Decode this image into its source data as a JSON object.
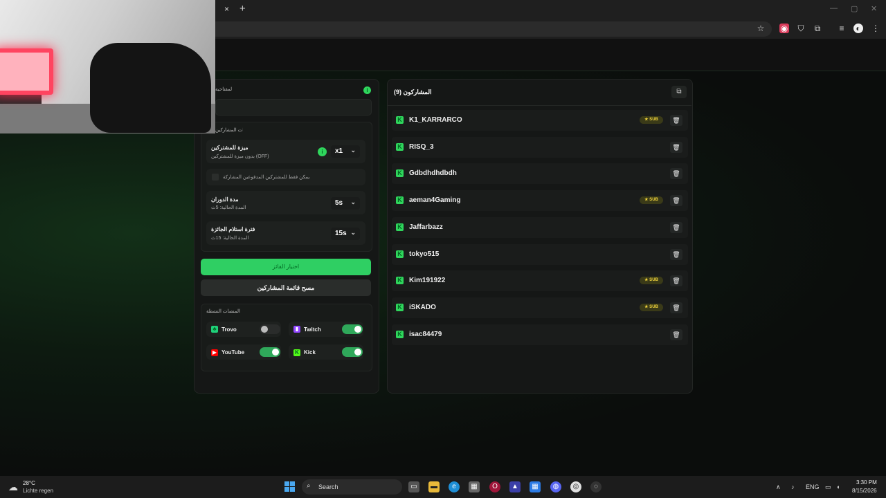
{
  "browser": {
    "tab_close": "×",
    "new_tab": "+",
    "win_min": "—",
    "win_max": "▢",
    "win_close": "✕"
  },
  "left": {
    "keyword_label": "الكلمة المفتاحية",
    "settings_title": "إعدادات المشاركين",
    "advantage": {
      "title": "ميزة للمشتركين",
      "subtitle": "بدون ميزة للمشتركين (OFF)",
      "value": "x1"
    },
    "paid_only": {
      "label": "يمكن فقط للمشتركين المدفوعين المشاركة"
    },
    "spin": {
      "title": "مدة الدوران",
      "subtitle": "المدة الحالية: 5ث",
      "value": "5s"
    },
    "claim": {
      "title": "فترة استلام الجائزة",
      "subtitle": "المدة الحالية: 15ث",
      "value": "15s"
    },
    "pick_button": "اختيار الفائز",
    "clear_button": "مسح قائمة المشاركين",
    "platforms_title": "المنصات النشطة",
    "platforms": [
      {
        "name": "Trovo",
        "enabled": false,
        "color": "#1fd07a"
      },
      {
        "name": "Twitch",
        "enabled": true,
        "color": "#9146ff"
      },
      {
        "name": "YouTube",
        "enabled": true,
        "color": "#ff0000"
      },
      {
        "name": "Kick",
        "enabled": true,
        "color": "#53fc18"
      }
    ]
  },
  "participants": {
    "title": "المشاركون (9)",
    "sub_label": "★ SUB",
    "items": [
      {
        "name": "K1_KARRARCO",
        "sub": true
      },
      {
        "name": "RISQ_3",
        "sub": false
      },
      {
        "name": "Gdbdhdhdbdh",
        "sub": false
      },
      {
        "name": "aeman4Gaming",
        "sub": true
      },
      {
        "name": "Jaffarbazz",
        "sub": false
      },
      {
        "name": "tokyo515",
        "sub": false
      },
      {
        "name": "Kim191922",
        "sub": true
      },
      {
        "name": "iSKADO",
        "sub": true
      },
      {
        "name": "isac84479",
        "sub": false
      }
    ]
  },
  "taskbar": {
    "temp": "28°C",
    "weather": "Lichte regen",
    "search": "Search",
    "lang": "ENG",
    "time": "3:30 PM",
    "date": "8/15/2026"
  },
  "colors": {
    "accent": "#2fcf63",
    "sub_gold": "#f2d43d"
  }
}
